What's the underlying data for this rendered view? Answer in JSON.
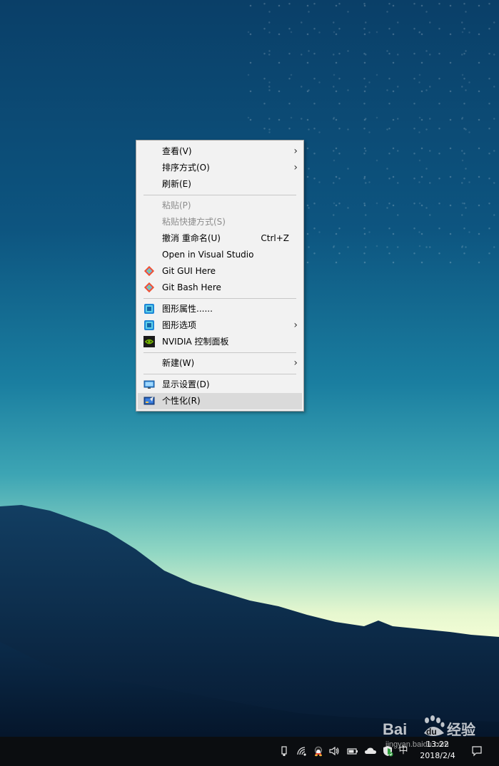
{
  "context_menu": {
    "items": [
      {
        "label": "查看(V)",
        "submenu": true
      },
      {
        "label": "排序方式(O)",
        "submenu": true
      },
      {
        "label": "刷新(E)"
      },
      {
        "label": "粘贴(P)",
        "disabled": true
      },
      {
        "label": "粘贴快捷方式(S)",
        "disabled": true
      },
      {
        "label": "撤消 重命名(U)",
        "shortcut": "Ctrl+Z"
      },
      {
        "label": "Open in Visual Studio"
      },
      {
        "label": "Git GUI Here",
        "icon": "git-icon"
      },
      {
        "label": "Git Bash Here",
        "icon": "git-icon"
      },
      {
        "label": "图形属性......",
        "icon": "intel-graphics-icon"
      },
      {
        "label": "图形选项",
        "icon": "intel-graphics-icon",
        "submenu": true
      },
      {
        "label": "NVIDIA 控制面板",
        "icon": "nvidia-icon"
      },
      {
        "label": "新建(W)",
        "submenu": true
      },
      {
        "label": "显示设置(D)",
        "icon": "display-icon"
      },
      {
        "label": "个性化(R)",
        "icon": "personalize-icon",
        "highlighted": true
      }
    ],
    "submenu_arrow": "›"
  },
  "taskbar": {
    "time": "13:22",
    "date": "2018/2/4",
    "tray_icons": [
      "usb-icon",
      "wifi-icon",
      "qq-icon",
      "volume-icon",
      "battery-icon",
      "onedrive-icon",
      "security-icon",
      "input-method-icon",
      "notification-icon"
    ],
    "input_method_label": "中"
  },
  "watermark": {
    "brand": "Bai",
    "brand_suffix": "du",
    "brand_cn": "经验",
    "url": "jingyan.baidu.com"
  },
  "colors": {
    "menu_bg": "#f2f2f2",
    "menu_hover": "#dadada",
    "taskbar_bg": "#0b0d10",
    "git_orange": "#f05133",
    "nvidia_green": "#76b900"
  }
}
